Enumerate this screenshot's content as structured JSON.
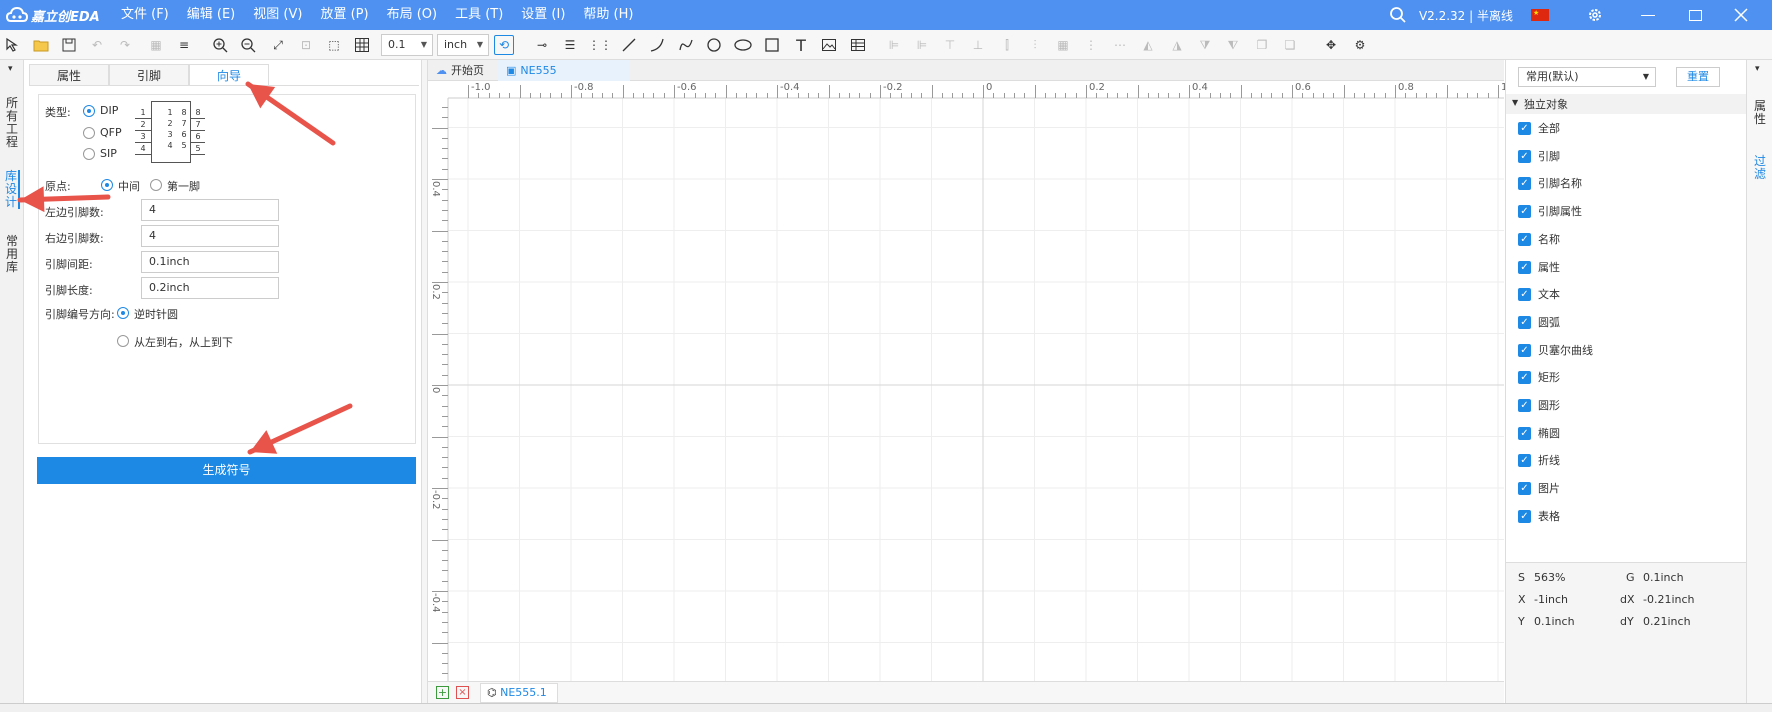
{
  "app": {
    "name": "嘉立创EDA",
    "version": "V2.2.32 | 半离线"
  },
  "menu": [
    "文件 (F)",
    "编辑 (E)",
    "视图 (V)",
    "放置 (P)",
    "布局 (O)",
    "工具 (T)",
    "设置 (I)",
    "帮助 (H)"
  ],
  "toolbar": {
    "grid_value": "0.1",
    "unit_value": "inch"
  },
  "left_strip": {
    "all_projects": "所有工程",
    "lib_design": "库设计",
    "common_lib": "常用库"
  },
  "panel": {
    "tabs": [
      "属性",
      "引脚",
      "向导"
    ],
    "active_tab": "向导",
    "type_label": "类型:",
    "types": [
      "DIP",
      "QFP",
      "SIP"
    ],
    "selected_type": "DIP",
    "chip_pins_left": [
      "1",
      "2",
      "3",
      "4"
    ],
    "chip_pins_right": [
      "8",
      "7",
      "6",
      "5"
    ],
    "origin_label": "原点:",
    "origin_options": [
      "中间",
      "第一脚"
    ],
    "left_pins_label": "左边引脚数:",
    "left_pins": "4",
    "right_pins_label": "右边引脚数:",
    "right_pins": "4",
    "pin_spacing_label": "引脚间距:",
    "pin_spacing": "0.1inch",
    "pin_length_label": "引脚长度:",
    "pin_length": "0.2inch",
    "pin_dir_label": "引脚编号方向:",
    "pin_dir_options": [
      "逆时针圆",
      "从左到右，从上到下"
    ],
    "generate_button": "生成符号"
  },
  "canvas": {
    "tabs": [
      "开始页",
      "NE555"
    ],
    "ruler_top": [
      "-1.0",
      "-0.8",
      "-0.6",
      "-0.4",
      "-0.2",
      "0",
      "0.2",
      "0.4",
      "0.6",
      "0.8",
      "1"
    ],
    "ruler_left": [
      "0.4",
      "0.2",
      "0",
      "-0.2",
      "-0.4"
    ],
    "bottom_tab": "NE555.1"
  },
  "filter": {
    "preset": "常用(默认)",
    "reset": "重置",
    "section": "独立对象",
    "items": [
      "全部",
      "引脚",
      "引脚名称",
      "引脚属性",
      "名称",
      "属性",
      "文本",
      "圆弧",
      "贝塞尔曲线",
      "矩形",
      "圆形",
      "椭圆",
      "折线",
      "图片",
      "表格"
    ]
  },
  "status": {
    "s_label": "S",
    "s_value": "563%",
    "g_label": "G",
    "g_value": "0.1inch",
    "x_label": "X",
    "x_value": "-1inch",
    "dx_label": "dX",
    "dx_value": "-0.21inch",
    "y_label": "Y",
    "y_value": "0.1inch",
    "dy_label": "dY",
    "dy_value": "0.21inch"
  },
  "right_strip": {
    "props": "属性",
    "filter": "过滤"
  },
  "colors": {
    "title_bar": "#4e91f0",
    "accent": "#1e88e5",
    "arrow": "#e8534a"
  }
}
